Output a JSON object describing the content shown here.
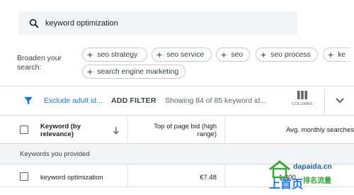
{
  "search": {
    "value": "keyword optimization"
  },
  "broaden": {
    "label": "Broaden your search:",
    "chips": [
      "seo strategy",
      "seo service",
      "seo",
      "seo process",
      "ke",
      "search engine marketing"
    ]
  },
  "toolbar": {
    "exclude_label": "Exclude adult id...",
    "add_filter_label": "ADD FILTER",
    "showing_text": "Showing 84 of 85 keyword id...",
    "columns_label": "COLUMNS"
  },
  "table": {
    "headers": {
      "keyword": "Keyword (by relevance)",
      "bid": "Top of page bid (high range)",
      "searches": "Avg. monthly searches"
    },
    "section_label": "Keywords you provided",
    "rows": [
      {
        "keyword": "keyword optimization",
        "bid": "€7.48",
        "searches": "1,300"
      }
    ]
  },
  "watermark": {
    "site": "dapaida.cn",
    "brand": "上首页",
    "tag1": "排名",
    "tag2": "流量"
  },
  "colors": {
    "accent": "#1a73e8",
    "chip_border": "#c7c9cc",
    "search_bg": "#f1f3f4"
  }
}
